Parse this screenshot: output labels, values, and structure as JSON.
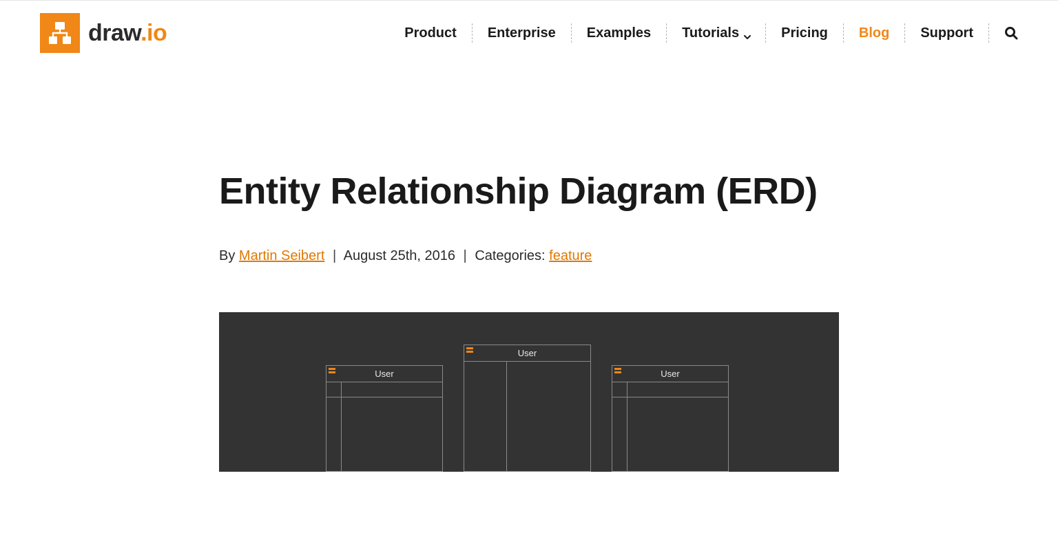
{
  "brand": {
    "name_part1": "draw",
    "name_dot": ".",
    "name_part2": "io"
  },
  "nav": {
    "items": [
      {
        "label": "Product",
        "has_submenu": false,
        "active": false
      },
      {
        "label": "Enterprise",
        "has_submenu": false,
        "active": false
      },
      {
        "label": "Examples",
        "has_submenu": false,
        "active": false
      },
      {
        "label": "Tutorials",
        "has_submenu": true,
        "active": false
      },
      {
        "label": "Pricing",
        "has_submenu": false,
        "active": false
      },
      {
        "label": "Blog",
        "has_submenu": false,
        "active": true
      },
      {
        "label": "Support",
        "has_submenu": false,
        "active": false
      }
    ]
  },
  "article": {
    "title": "Entity Relationship Diagram (ERD)",
    "by_label": "By ",
    "author": "Martin Seibert",
    "date": "August 25th, 2016",
    "categories_label": "Categories: ",
    "category": "feature"
  },
  "hero": {
    "entity_label": "User"
  }
}
